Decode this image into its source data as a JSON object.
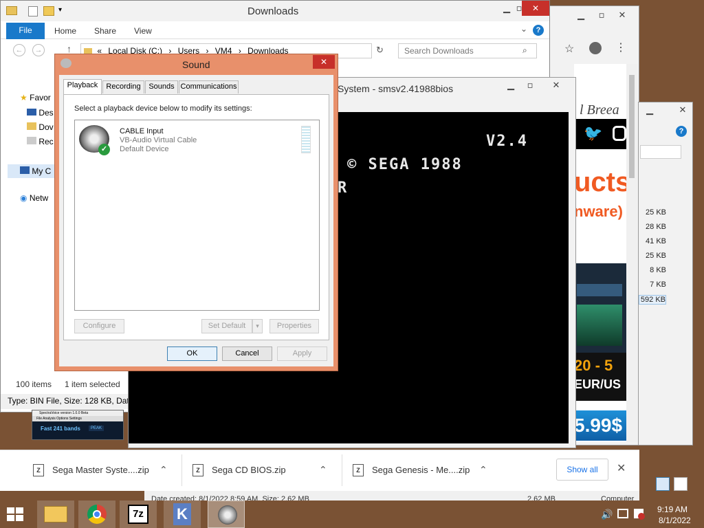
{
  "explorer": {
    "title": "Downloads",
    "ribbon_tabs": [
      "File",
      "Home",
      "Share",
      "View"
    ],
    "address": [
      "Local Disk (C:)",
      "Users",
      "VM4",
      "Downloads"
    ],
    "address_prefix": "«",
    "search_placeholder": "Search Downloads",
    "nav": [
      "Favor",
      "Des",
      "Dov",
      "Rec",
      "My C",
      "Netw"
    ],
    "status_items": "100 items",
    "status_selected": "1 item selected",
    "type_line": "Type: BIN File, Size: 128 KB, Date",
    "details_line": "Date created: 8/1/2022 8:59 AM, Size: 2.62 MB",
    "details_size": "2.62 MB",
    "details_computer": "Computer"
  },
  "emulator": {
    "title": "System - smsv2.41988bios",
    "line1": "V2.4",
    "line2": "© SEGA 1988",
    "line3": "R"
  },
  "browser": {
    "brand_text": "l Breea",
    "heading": "ucts",
    "subheading": "nware)",
    "promo1": "20 - 5",
    "promo2": "EUR/US",
    "price": "5.99$"
  },
  "browser2": {
    "sizes": [
      "25 KB",
      "28 KB",
      "41 KB",
      "25 KB",
      "8 KB",
      "7 KB",
      "592 KB"
    ]
  },
  "thumbnail": {
    "title": "SpectraVoice version 1.0.0 Beta",
    "menu": "File Analysis Options Settings",
    "label": "Fast 241 bands",
    "peak": "PEAK"
  },
  "sound": {
    "title": "Sound",
    "tabs": [
      "Playback",
      "Recording",
      "Sounds",
      "Communications"
    ],
    "instruction": "Select a playback device below to modify its settings:",
    "device": {
      "name": "CABLE Input",
      "desc": "VB-Audio Virtual Cable",
      "status": "Default Device"
    },
    "configure": "Configure",
    "set_default": "Set Default",
    "properties": "Properties",
    "ok": "OK",
    "cancel": "Cancel",
    "apply": "Apply"
  },
  "downloads": {
    "items": [
      "Sega Master Syste....zip",
      "Sega CD BIOS.zip",
      "Sega Genesis - Me....zip"
    ],
    "show_all": "Show all"
  },
  "taskbar": {
    "time": "9:19 AM",
    "date": "8/1/2022",
    "sevenzip": "7z"
  },
  "colors": {
    "accent_blue": "#1979ca",
    "dialog_frame": "#e8906b",
    "close_red": "#c7302a",
    "taskbar": "#7a5234"
  }
}
